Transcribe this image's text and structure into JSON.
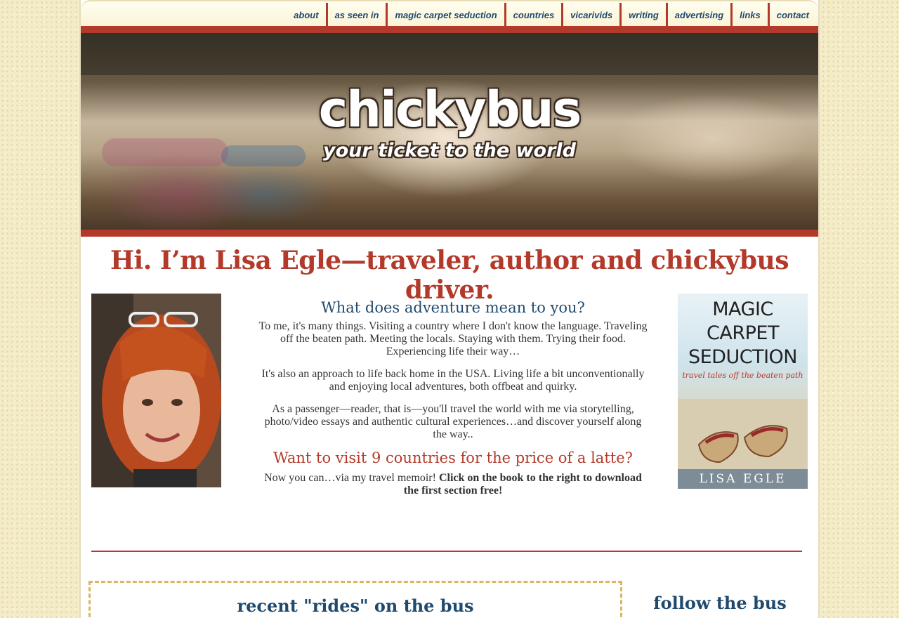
{
  "nav": {
    "items": [
      "about",
      "as seen in",
      "magic carpet seduction",
      "countries",
      "vicarivids",
      "writing",
      "advertising",
      "links",
      "contact"
    ]
  },
  "banner": {
    "logo_text": "chickybus",
    "tagline": "your ticket to the world"
  },
  "headline": "Hi. I’m Lisa Egle—traveler, author and chickybus driver.",
  "intro": {
    "question1": "What does adventure mean to you?",
    "para1": "To me, it's many things. Visiting a country where I don't know the language. Traveling off the beaten path. Meeting the locals. Staying with them. Trying their food. Experiencing life their way…",
    "para2": "It's also an approach to life back home in the USA. Living life a bit unconventionally and enjoying local adventures, both offbeat and quirky.",
    "para3": "As a passenger—reader, that is—you'll travel the world with me via storytelling, photo/video essays and authentic cultural experiences…and discover yourself along the way..",
    "question2": "Want to visit 9 countries for the price of a latte?",
    "cta_plain": "Now you can…via my travel memoir! ",
    "cta_bold": "Click on the book to the right to download the first section free!"
  },
  "book": {
    "title_line1": "MAGIC",
    "title_line2": "CARPET",
    "title_line3": "SEDUCTION",
    "subtitle": "travel tales off the beaten path",
    "author": "LISA EGLE"
  },
  "sections": {
    "recent_rides": "recent \"rides\" on the bus",
    "follow": "follow the bus"
  },
  "colors": {
    "accent_red": "#b33a2a",
    "heading_blue": "#1f4a6e",
    "dashed_gold": "#d7b85f"
  }
}
